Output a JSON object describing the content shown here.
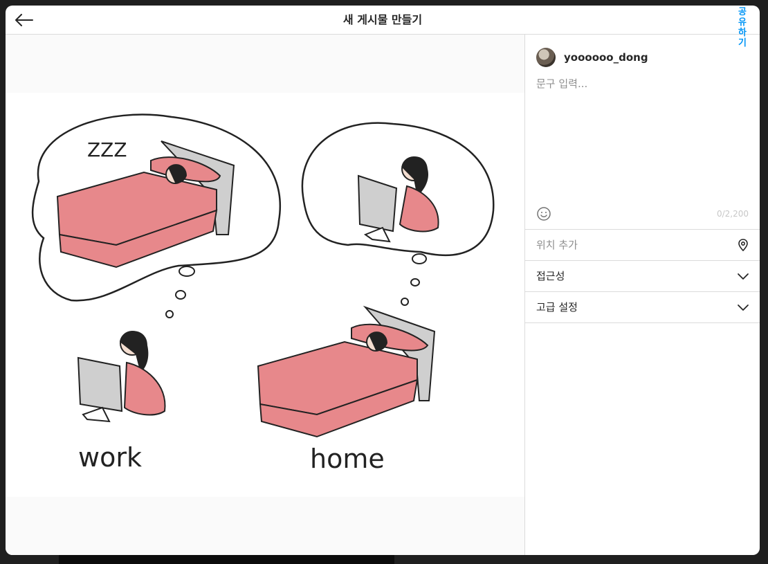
{
  "header": {
    "title": "새 게시물 만들기",
    "share_label": "공유하기"
  },
  "post": {
    "username": "yoooooo_dong",
    "caption_placeholder": "문구 입력...",
    "char_count": "0/2,200"
  },
  "image": {
    "captions": [
      "work",
      "home"
    ],
    "sleep_text": "ZZZ"
  },
  "panel": {
    "location_label": "위치 추가",
    "accessibility_label": "접근성",
    "advanced_label": "고급 설정"
  },
  "colors": {
    "accent": "#0095f6",
    "bed": "#e7888b",
    "border": "#dbdbdb"
  }
}
